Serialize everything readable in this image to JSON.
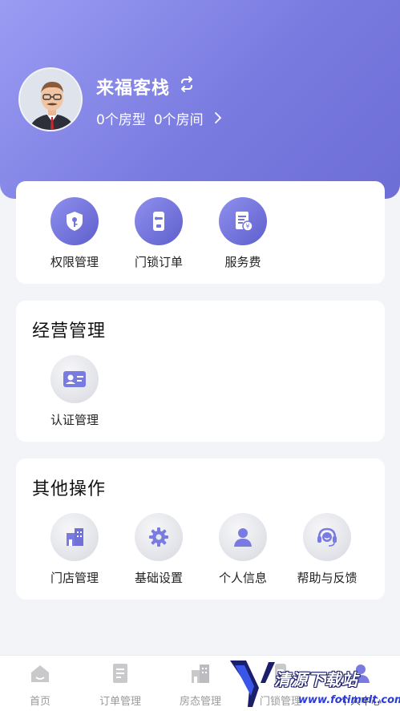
{
  "header": {
    "store_name": "来福客栈",
    "room_types": "0个房型",
    "rooms": "0个房间"
  },
  "quick_actions": [
    {
      "label": "权限管理",
      "icon": "shield-key-icon"
    },
    {
      "label": "门锁订单",
      "icon": "door-lock-icon"
    },
    {
      "label": "服务费",
      "icon": "bill-yen-icon"
    }
  ],
  "business": {
    "title": "经营管理",
    "items": [
      {
        "label": "认证管理",
        "icon": "id-card-icon"
      }
    ]
  },
  "other": {
    "title": "其他操作",
    "items": [
      {
        "label": "门店管理",
        "icon": "store-icon"
      },
      {
        "label": "基础设置",
        "icon": "gear-icon"
      },
      {
        "label": "个人信息",
        "icon": "person-icon"
      },
      {
        "label": "帮助与反馈",
        "icon": "headset-icon"
      }
    ]
  },
  "tabbar": [
    {
      "label": "首页",
      "icon": "home-icon"
    },
    {
      "label": "订单管理",
      "icon": "order-icon"
    },
    {
      "label": "房态管理",
      "icon": "room-status-icon"
    },
    {
      "label": "门锁管理",
      "icon": "lock-icon"
    },
    {
      "label": "个人中心",
      "icon": "profile-icon"
    }
  ],
  "watermark": {
    "text": "清源下载站",
    "url": "www.fotimelt.com"
  },
  "colors": {
    "accent": "#7a7be0",
    "accent_dark": "#5f5fcc",
    "tab_inactive": "#9a9a9a"
  }
}
